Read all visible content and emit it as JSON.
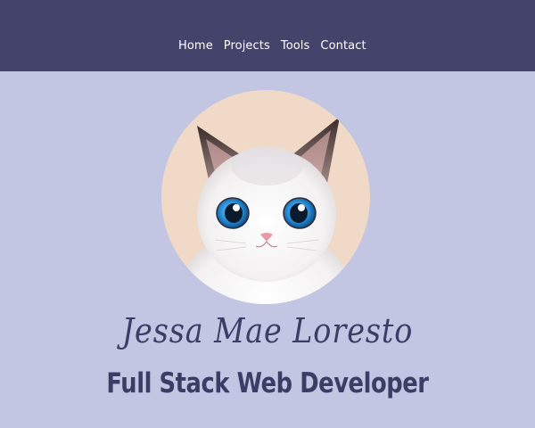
{
  "nav": {
    "items": [
      {
        "label": "Home"
      },
      {
        "label": "Projects"
      },
      {
        "label": "Tools"
      },
      {
        "label": "Contact"
      }
    ]
  },
  "hero": {
    "name": "Jessa Mae Loresto",
    "title": "Full Stack Web Developer",
    "avatar_icon": "cat-avatar-icon"
  },
  "colors": {
    "navbar_bg": "#43436b",
    "page_bg": "#c3c6e3",
    "avatar_bg": "#f0d9c7",
    "text_primary": "#3c3c66",
    "nav_text": "#ffffff"
  }
}
